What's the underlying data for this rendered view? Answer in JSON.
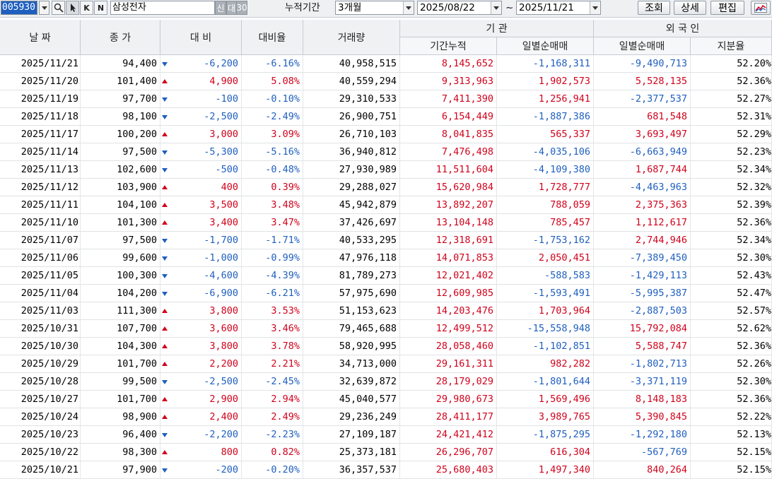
{
  "toolbar": {
    "stock_code": "005930",
    "btn_k": "K",
    "btn_n": "N",
    "stock_name": "삼성전자",
    "btn_sin": "신",
    "btn_dae": "대",
    "btn_30": "30",
    "period_label": "누적기간",
    "period_value": "3개월",
    "start_date": "2025/08/22",
    "tilde": "~",
    "end_date": "2025/11/21",
    "query_btn": "조회",
    "detail_btn": "상세",
    "edit_btn": "편집"
  },
  "header": {
    "date": "날 짜",
    "close": "종 가",
    "change": "대 비",
    "change_pct": "대비율",
    "volume": "거래량",
    "inst_group": "기 관",
    "inst_cum": "기간누적",
    "inst_net": "일별순매매",
    "foreign_group": "외 국 인",
    "foreign_net": "일별순매매",
    "foreign_share": "지분율"
  },
  "rows": [
    {
      "date": "2025/11/21",
      "close": "94,400",
      "dir": "down",
      "change": "-6,200",
      "pct": "-6.16%",
      "volume": "40,958,515",
      "inst_cum": "8,145,652",
      "inst_net": "-1,168,311",
      "foreign_net": "-9,490,713",
      "share": "52.20%"
    },
    {
      "date": "2025/11/20",
      "close": "101,400",
      "dir": "up",
      "change": "4,900",
      "pct": "5.08%",
      "volume": "40,559,294",
      "inst_cum": "9,313,963",
      "inst_net": "1,902,573",
      "foreign_net": "5,528,135",
      "share": "52.36%"
    },
    {
      "date": "2025/11/19",
      "close": "97,700",
      "dir": "down",
      "change": "-100",
      "pct": "-0.10%",
      "volume": "29,310,533",
      "inst_cum": "7,411,390",
      "inst_net": "1,256,941",
      "foreign_net": "-2,377,537",
      "share": "52.27%"
    },
    {
      "date": "2025/11/18",
      "close": "98,100",
      "dir": "down",
      "change": "-2,500",
      "pct": "-2.49%",
      "volume": "26,900,751",
      "inst_cum": "6,154,449",
      "inst_net": "-1,887,386",
      "foreign_net": "681,548",
      "share": "52.31%"
    },
    {
      "date": "2025/11/17",
      "close": "100,200",
      "dir": "up",
      "change": "3,000",
      "pct": "3.09%",
      "volume": "26,710,103",
      "inst_cum": "8,041,835",
      "inst_net": "565,337",
      "foreign_net": "3,693,497",
      "share": "52.29%"
    },
    {
      "date": "2025/11/14",
      "close": "97,500",
      "dir": "down",
      "change": "-5,300",
      "pct": "-5.16%",
      "volume": "36,940,812",
      "inst_cum": "7,476,498",
      "inst_net": "-4,035,106",
      "foreign_net": "-6,663,949",
      "share": "52.23%"
    },
    {
      "date": "2025/11/13",
      "close": "102,600",
      "dir": "down",
      "change": "-500",
      "pct": "-0.48%",
      "volume": "27,930,989",
      "inst_cum": "11,511,604",
      "inst_net": "-4,109,380",
      "foreign_net": "1,687,744",
      "share": "52.34%"
    },
    {
      "date": "2025/11/12",
      "close": "103,900",
      "dir": "up",
      "change": "400",
      "pct": "0.39%",
      "volume": "29,288,027",
      "inst_cum": "15,620,984",
      "inst_net": "1,728,777",
      "foreign_net": "-4,463,963",
      "share": "52.32%"
    },
    {
      "date": "2025/11/11",
      "close": "104,100",
      "dir": "up",
      "change": "3,500",
      "pct": "3.48%",
      "volume": "45,942,879",
      "inst_cum": "13,892,207",
      "inst_net": "788,059",
      "foreign_net": "2,375,363",
      "share": "52.39%"
    },
    {
      "date": "2025/11/10",
      "close": "101,300",
      "dir": "up",
      "change": "3,400",
      "pct": "3.47%",
      "volume": "37,426,697",
      "inst_cum": "13,104,148",
      "inst_net": "785,457",
      "foreign_net": "1,112,617",
      "share": "52.36%"
    },
    {
      "date": "2025/11/07",
      "close": "97,500",
      "dir": "down",
      "change": "-1,700",
      "pct": "-1.71%",
      "volume": "40,533,295",
      "inst_cum": "12,318,691",
      "inst_net": "-1,753,162",
      "foreign_net": "2,744,946",
      "share": "52.34%"
    },
    {
      "date": "2025/11/06",
      "close": "99,600",
      "dir": "down",
      "change": "-1,000",
      "pct": "-0.99%",
      "volume": "47,976,118",
      "inst_cum": "14,071,853",
      "inst_net": "2,050,451",
      "foreign_net": "-7,389,450",
      "share": "52.30%"
    },
    {
      "date": "2025/11/05",
      "close": "100,300",
      "dir": "down",
      "change": "-4,600",
      "pct": "-4.39%",
      "volume": "81,789,273",
      "inst_cum": "12,021,402",
      "inst_net": "-588,583",
      "foreign_net": "-1,429,113",
      "share": "52.43%"
    },
    {
      "date": "2025/11/04",
      "close": "104,200",
      "dir": "down",
      "change": "-6,900",
      "pct": "-6.21%",
      "volume": "57,975,690",
      "inst_cum": "12,609,985",
      "inst_net": "-1,593,491",
      "foreign_net": "-5,995,387",
      "share": "52.47%"
    },
    {
      "date": "2025/11/03",
      "close": "111,300",
      "dir": "up",
      "change": "3,800",
      "pct": "3.53%",
      "volume": "51,153,623",
      "inst_cum": "14,203,476",
      "inst_net": "1,703,964",
      "foreign_net": "-2,887,503",
      "share": "52.57%"
    },
    {
      "date": "2025/10/31",
      "close": "107,700",
      "dir": "up",
      "change": "3,600",
      "pct": "3.46%",
      "volume": "79,465,688",
      "inst_cum": "12,499,512",
      "inst_net": "-15,558,948",
      "foreign_net": "15,792,084",
      "share": "52.62%"
    },
    {
      "date": "2025/10/30",
      "close": "104,300",
      "dir": "up",
      "change": "3,800",
      "pct": "3.78%",
      "volume": "58,920,995",
      "inst_cum": "28,058,460",
      "inst_net": "-1,102,851",
      "foreign_net": "5,588,747",
      "share": "52.36%"
    },
    {
      "date": "2025/10/29",
      "close": "101,700",
      "dir": "up",
      "change": "2,200",
      "pct": "2.21%",
      "volume": "34,713,000",
      "inst_cum": "29,161,311",
      "inst_net": "982,282",
      "foreign_net": "-1,802,713",
      "share": "52.26%"
    },
    {
      "date": "2025/10/28",
      "close": "99,500",
      "dir": "down",
      "change": "-2,500",
      "pct": "-2.45%",
      "volume": "32,639,872",
      "inst_cum": "28,179,029",
      "inst_net": "-1,801,644",
      "foreign_net": "-3,371,119",
      "share": "52.30%"
    },
    {
      "date": "2025/10/27",
      "close": "101,700",
      "dir": "up",
      "change": "2,900",
      "pct": "2.94%",
      "volume": "45,040,577",
      "inst_cum": "29,980,673",
      "inst_net": "1,569,496",
      "foreign_net": "8,148,183",
      "share": "52.36%"
    },
    {
      "date": "2025/10/24",
      "close": "98,900",
      "dir": "up",
      "change": "2,400",
      "pct": "2.49%",
      "volume": "29,236,249",
      "inst_cum": "28,411,177",
      "inst_net": "3,989,765",
      "foreign_net": "5,390,845",
      "share": "52.22%"
    },
    {
      "date": "2025/10/23",
      "close": "96,400",
      "dir": "down",
      "change": "-2,200",
      "pct": "-2.23%",
      "volume": "27,109,187",
      "inst_cum": "24,421,412",
      "inst_net": "-1,875,295",
      "foreign_net": "-1,292,180",
      "share": "52.13%"
    },
    {
      "date": "2025/10/22",
      "close": "98,300",
      "dir": "up",
      "change": "800",
      "pct": "0.82%",
      "volume": "25,373,181",
      "inst_cum": "26,296,707",
      "inst_net": "616,304",
      "foreign_net": "-567,769",
      "share": "52.15%"
    },
    {
      "date": "2025/10/21",
      "close": "97,900",
      "dir": "down",
      "change": "-200",
      "pct": "-0.20%",
      "volume": "36,357,537",
      "inst_cum": "25,680,403",
      "inst_net": "1,497,340",
      "foreign_net": "840,264",
      "share": "52.15%"
    }
  ],
  "colors": {
    "up": "#d0021b",
    "down": "#1f5fbf",
    "header_bg": "#eff1f3",
    "code_bg": "#1f5fbf"
  }
}
